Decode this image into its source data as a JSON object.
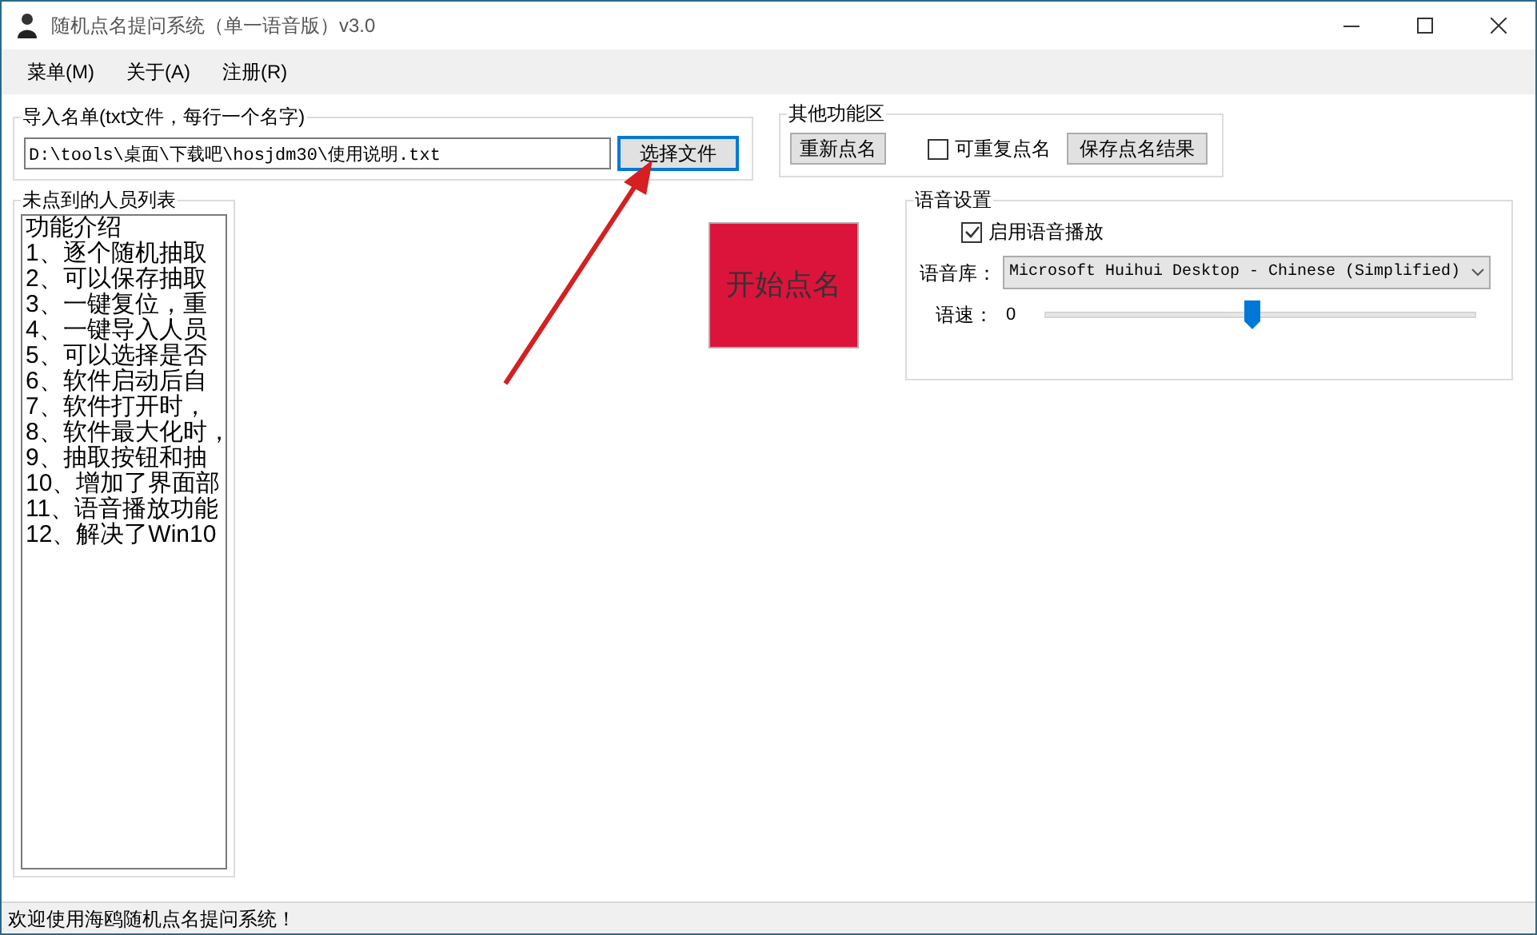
{
  "window": {
    "title": "随机点名提问系统（单一语音版）v3.0"
  },
  "menu": [
    "菜单(M)",
    "关于(A)",
    "注册(R)"
  ],
  "import_group": {
    "title": "导入名单(txt文件，每行一个名字)",
    "path": "D:\\tools\\桌面\\下载吧\\hosjdm30\\使用说明.txt",
    "button": "选择文件"
  },
  "other_group": {
    "title": "其他功能区",
    "reset_button": "重新点名",
    "repeat_checkbox": {
      "label": "可重复点名",
      "checked": false
    },
    "save_button": "保存点名结果"
  },
  "list_group": {
    "title": "未点到的人员列表",
    "lines": [
      "功能介绍",
      "1、逐个随机抽取",
      "2、可以保存抽取",
      "3、一键复位，重",
      "4、一键导入人员",
      "5、可以选择是否",
      "6、软件启动后自",
      "7、软件打开时，",
      "8、软件最大化时，",
      "9、抽取按钮和抽",
      "10、增加了界面部",
      "11、语音播放功能",
      "12、解决了Win10"
    ]
  },
  "start_button": "开始点名",
  "voice_group": {
    "title": "语音设置",
    "enable_checkbox": {
      "label": "启用语音播放",
      "checked": true
    },
    "library_label": "语音库：",
    "library_value": "Microsoft Huihui Desktop - Chinese (Simplified)",
    "speed_label": "语速：",
    "speed_value": "0",
    "speed_slider": {
      "level": 0.48
    }
  },
  "status_bar": "欢迎使用海鸥随机点名提问系统！"
}
